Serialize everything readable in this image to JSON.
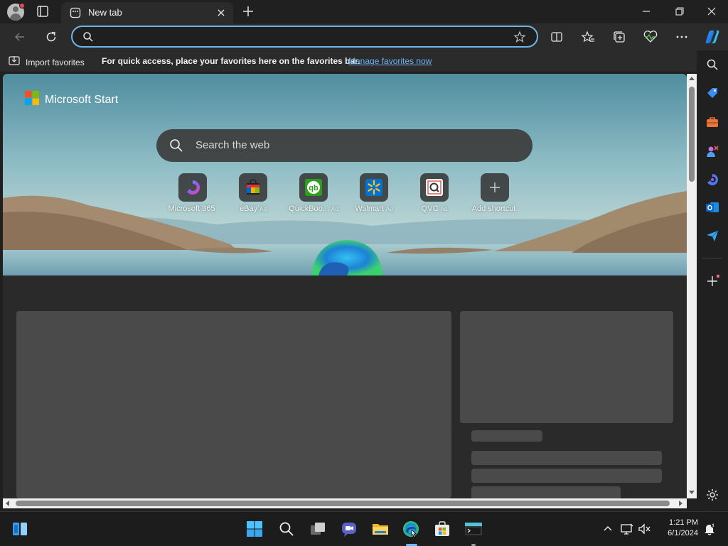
{
  "window": {
    "tab_title": "New tab",
    "tab_close_label": "×",
    "new_tab_label": "+",
    "minimize_label": "Minimize",
    "maximize_label": "Restore",
    "close_label": "Close"
  },
  "address_bar": {
    "value": "",
    "placeholder": ""
  },
  "favorites_bar": {
    "import_label": "Import favorites",
    "message": "For quick access, place your favorites here on the favorites bar.",
    "manage_link": "Manage favorites now"
  },
  "newtab": {
    "brand": "Microsoft Start",
    "search_placeholder": "Search the web",
    "shortcuts": [
      {
        "label": "Microsoft 365",
        "ad": "",
        "icon": "m365-icon"
      },
      {
        "label": "eBay",
        "ad": "Ad",
        "icon": "ebay-icon"
      },
      {
        "label": "QuickBoo...",
        "ad": "Ad",
        "icon": "quickbooks-icon"
      },
      {
        "label": "Walmart",
        "ad": "Ad",
        "icon": "walmart-icon"
      },
      {
        "label": "QVC",
        "ad": "Ad",
        "icon": "qvc-icon"
      },
      {
        "label": "Add shortcut",
        "ad": "",
        "icon": "plus-icon"
      }
    ]
  },
  "taskbar": {
    "time": "1:21 PM",
    "date": "6/1/2024"
  },
  "colors": {
    "accent": "#6cb5e6",
    "link": "#6db3f2",
    "window_bg": "#202020",
    "toolbar_bg": "#2b2b2b"
  }
}
